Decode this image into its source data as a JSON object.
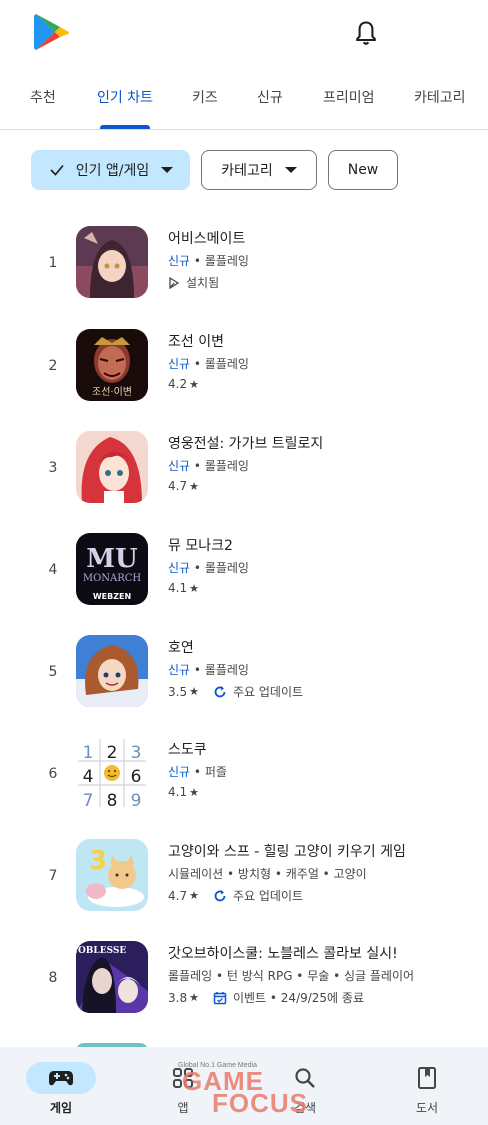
{
  "header": {
    "logo": "google-play-logo",
    "notification_icon": "bell-icon"
  },
  "tabs": [
    {
      "label": "추천",
      "active": false
    },
    {
      "label": "인기 차트",
      "active": true
    },
    {
      "label": "키즈",
      "active": false
    },
    {
      "label": "신규",
      "active": false
    },
    {
      "label": "프리미엄",
      "active": false
    },
    {
      "label": "카테고리",
      "active": false
    }
  ],
  "filters": {
    "chart": "인기 앱/게임",
    "category": "카테고리",
    "new": "New"
  },
  "apps": [
    {
      "rank": "1",
      "name": "어비스메이트",
      "new": "신규",
      "genre": "롤플레잉",
      "sub": "설치됨"
    },
    {
      "rank": "2",
      "name": "조선 이변",
      "new": "신규",
      "genre": "롤플레잉",
      "rating": "4.2"
    },
    {
      "rank": "3",
      "name": "영웅전설: 가가브 트릴로지",
      "new": "신규",
      "genre": "롤플레잉",
      "rating": "4.7"
    },
    {
      "rank": "4",
      "name": "뮤 모나크2",
      "new": "신규",
      "genre": "롤플레잉",
      "rating": "4.1"
    },
    {
      "rank": "5",
      "name": "호연",
      "new": "신규",
      "genre": "롤플레잉",
      "rating": "3.5",
      "badge": "주요 업데이트"
    },
    {
      "rank": "6",
      "name": "스도쿠",
      "new": "신규",
      "genre": "퍼즐",
      "rating": "4.1"
    },
    {
      "rank": "7",
      "name": "고양이와 스프 - 힐링 고양이 키우기 게임",
      "genre": "시뮬레이션 • 방치형 • 캐주얼 • 고양이",
      "rating": "4.7",
      "badge": "주요 업데이트"
    },
    {
      "rank": "8",
      "name": "갓오브하이스쿨: 노블레스 콜라보 실시!",
      "genre": "롤플레잉 • 턴 방식 RPG • 무술 • 싱글 플레이어",
      "rating": "3.8",
      "badge": "이벤트 • 24/9/25에 종료"
    }
  ],
  "icon_texts": {
    "app2": "조선·이변",
    "app4_mu": "MU",
    "app4_monarch": "MONARCH",
    "app4_brand": "WEBZEN",
    "app7_num": "3",
    "app8_logo": "NOBLESSE",
    "sudoku": [
      "1",
      "2",
      "3",
      "4",
      "",
      "6",
      "7",
      "8",
      "9"
    ]
  },
  "bottom_nav": [
    {
      "label": "게임",
      "icon": "gamepad-icon",
      "active": true
    },
    {
      "label": "앱",
      "icon": "apps-icon",
      "active": false
    },
    {
      "label": "검색",
      "icon": "search-icon",
      "active": false
    },
    {
      "label": "도서",
      "icon": "book-icon",
      "active": false
    }
  ],
  "watermark": {
    "tagline": "Global No.1 Game Media",
    "line1": "GAME",
    "line2": "FOCUS"
  },
  "colors": {
    "accent": "#0b57d0",
    "chip_selected": "#c2e7ff",
    "nav_bg": "#f0f4f9"
  }
}
